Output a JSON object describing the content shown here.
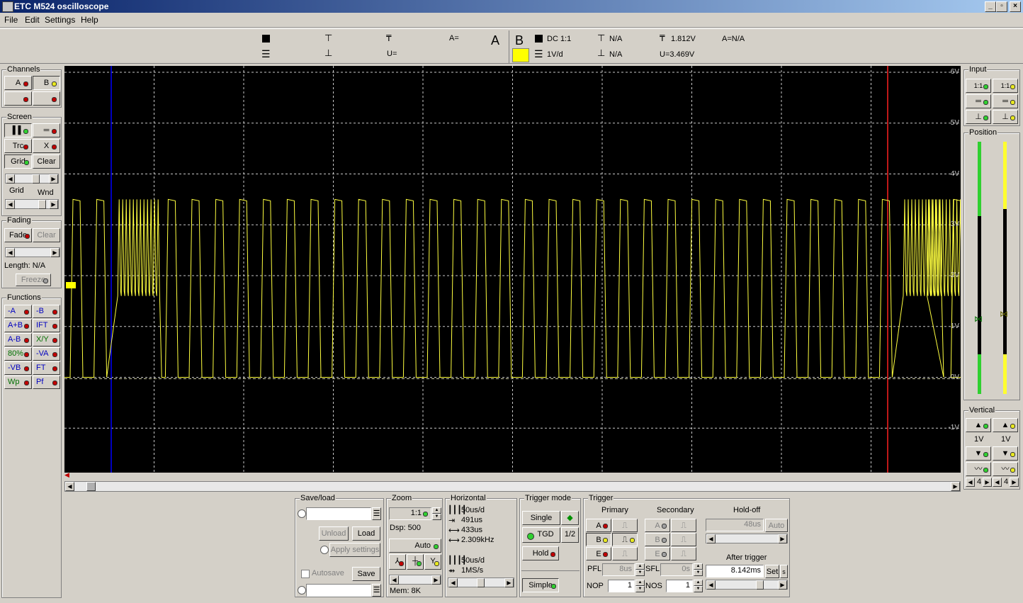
{
  "window": {
    "title": "ETC M524 oscilloscope"
  },
  "menu": [
    "File",
    "Edit",
    "Settings",
    "Help"
  ],
  "info_bar": {
    "chA": {
      "a_eq": "A=",
      "u_eq": "U=",
      "big_letter": "A"
    },
    "chB": {
      "letter": "B",
      "coupling": "DC 1:1",
      "volts_div": "1V/d",
      "t1": "N/A",
      "t2": "N/A",
      "trig_level": "1.812V",
      "a_eq": "A=N/A",
      "u_eq": "U=3.469V",
      "color": "#ffff00"
    }
  },
  "left_panel": {
    "channels": {
      "title": "Channels",
      "a": "A",
      "b": "B"
    },
    "screen": {
      "title": "Screen",
      "trc": "Trc",
      "x": "X",
      "grid": "Grid",
      "clear": "Clear",
      "grid_label": "Grid",
      "wnd_label": "Wnd"
    },
    "fading": {
      "title": "Fading",
      "fade": "Fade",
      "clear": "Clear",
      "length": "Length: N/A",
      "freeze": "Freeze"
    },
    "functions": {
      "title": "Functions",
      "items": [
        "-A",
        "-B",
        "A+B",
        "IFT",
        "A-B",
        "X/Y",
        "80%",
        "-VA",
        "-VB",
        "FT",
        "Wp",
        "Pf"
      ]
    }
  },
  "scope": {
    "y_labels": [
      "6V",
      "5V",
      "4V",
      "3V",
      "2V",
      "1V",
      "0V",
      "-1V"
    ],
    "trace_color": "#ffff40",
    "grid_color": "#c8c8c8",
    "cursor_blue": "#0000ff",
    "cursor_red": "#ff2020"
  },
  "right_panel": {
    "input": {
      "title": "Input",
      "r1": "1:1",
      "r2": "1:1"
    },
    "position": {
      "title": "Position"
    },
    "vertical": {
      "title": "Vertical",
      "v1": "1V",
      "v2": "1V",
      "n1": "4",
      "n2": "4"
    }
  },
  "save_load": {
    "title": "Save/load",
    "unload": "Unload",
    "load": "Load",
    "apply": "Apply settings",
    "autosave": "Autosave",
    "save": "Save"
  },
  "zoom": {
    "title": "Zoom",
    "ratio": "1:1",
    "dsp": "Dsp:  500",
    "auto": "Auto",
    "mem": "Mem: 8K"
  },
  "horizontal": {
    "title": "Horizontal",
    "div": "50us/d",
    "t1": "491us",
    "t2": "433us",
    "freq": "2.309kHz",
    "div2": "50us/d",
    "rate": "1MS/s"
  },
  "trigger_mode": {
    "title": "Trigger mode",
    "single": "Single",
    "tgd": "TGD",
    "half": "1/2",
    "hold": "Hold",
    "simple": "Simple"
  },
  "trigger": {
    "title": "Trigger",
    "primary": "Primary",
    "secondary": "Secondary",
    "holdoff": "Hold-off",
    "holdoff_value": "48us",
    "auto": "Auto",
    "after_trigger": "After trigger",
    "after_value": "8.142ms",
    "set": "Set",
    "s": "s",
    "pfl": "PFL",
    "pfl_value": "8us",
    "sfl": "SFL",
    "sfl_value": "0s",
    "nop": "NOP",
    "nop_value": "1",
    "nos": "NOS",
    "nos_value": "1",
    "a": "A",
    "b": "B",
    "e": "E"
  }
}
